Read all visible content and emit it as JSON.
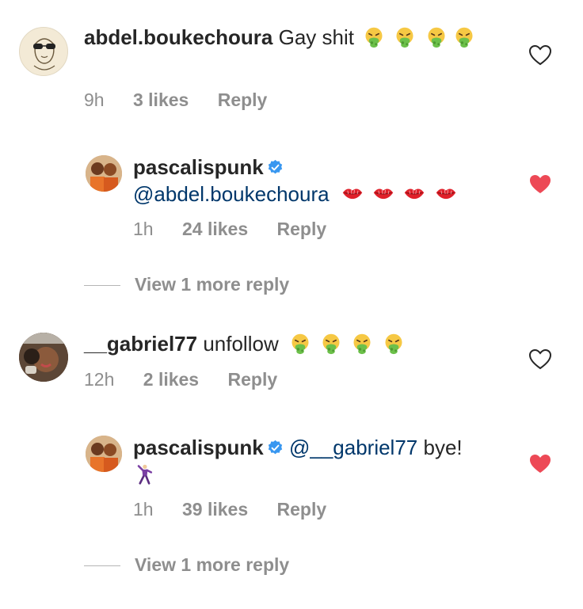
{
  "comments": [
    {
      "username": "abdel.boukechoura",
      "text": "Gay shit",
      "emoji": [
        "vomit",
        "vomit",
        "vomit",
        "vomit"
      ],
      "time": "9h",
      "likes": "3 likes",
      "reply": "Reply",
      "liked": false,
      "replies": [
        {
          "username": "pascalispunk",
          "verified": true,
          "mention": "@abdel.boukechoura",
          "emoji": [
            "kiss",
            "kiss",
            "kiss",
            "kiss"
          ],
          "time": "1h",
          "likes": "24 likes",
          "reply": "Reply",
          "liked": true
        }
      ],
      "view_more": "View 1 more reply"
    },
    {
      "username": "__gabriel77",
      "text": "unfollow",
      "emoji": [
        "vomit",
        "vomit",
        "vomit",
        "vomit"
      ],
      "time": "12h",
      "likes": "2 likes",
      "reply": "Reply",
      "liked": false,
      "replies": [
        {
          "username": "pascalispunk",
          "verified": true,
          "mention": "@__gabriel77",
          "text": "bye!",
          "emoji": [
            "man-dancing"
          ],
          "time": "1h",
          "likes": "39 likes",
          "reply": "Reply",
          "liked": true
        }
      ],
      "view_more": "View 1 more reply"
    }
  ],
  "colors": {
    "heart_liked": "#ed4956",
    "meta_gray": "#8e8e8e",
    "mention": "#00376b",
    "verified": "#3897f0"
  }
}
